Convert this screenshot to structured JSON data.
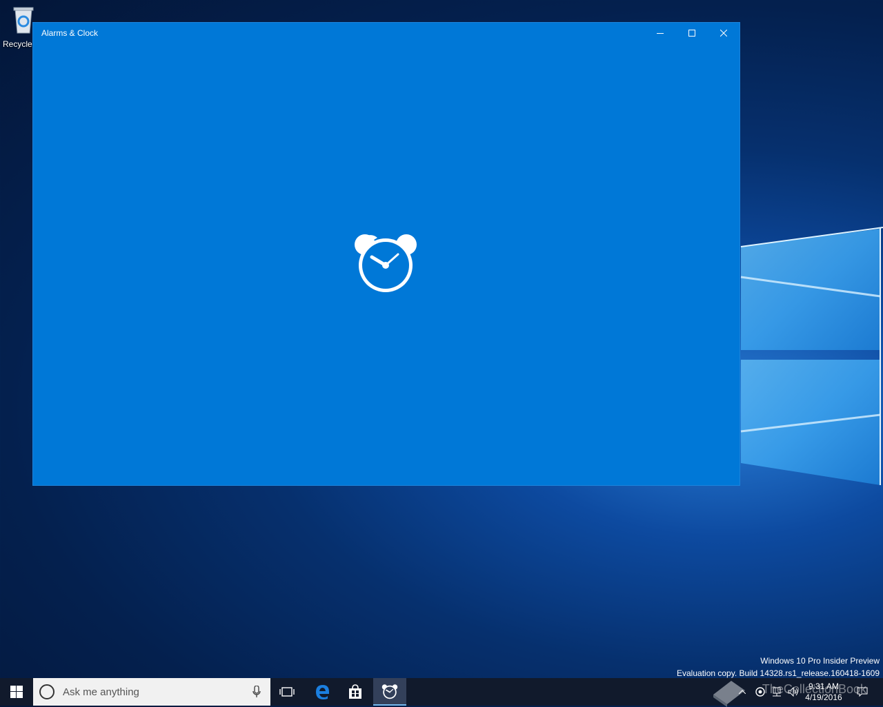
{
  "desktop": {
    "icons": [
      {
        "label": "Recycle Bin",
        "icon": "recycle-bin-icon"
      }
    ]
  },
  "window": {
    "title": "Alarms & Clock",
    "background": "#0078d7",
    "splash_icon": "alarm-clock-icon"
  },
  "watermark": {
    "line1": "Windows 10 Pro Insider Preview",
    "line2": "Evaluation copy. Build 14328.rs1_release.160418-1609"
  },
  "taskbar": {
    "search_placeholder": "Ask me anything",
    "apps": [
      "task-view-icon",
      "edge-icon",
      "store-icon",
      "alarms-clock-icon"
    ],
    "active_app": "alarms-clock-icon",
    "clock": {
      "time": "9:31 AM",
      "date": "4/19/2016"
    },
    "overlay_brand": "TheCollectionBook"
  }
}
